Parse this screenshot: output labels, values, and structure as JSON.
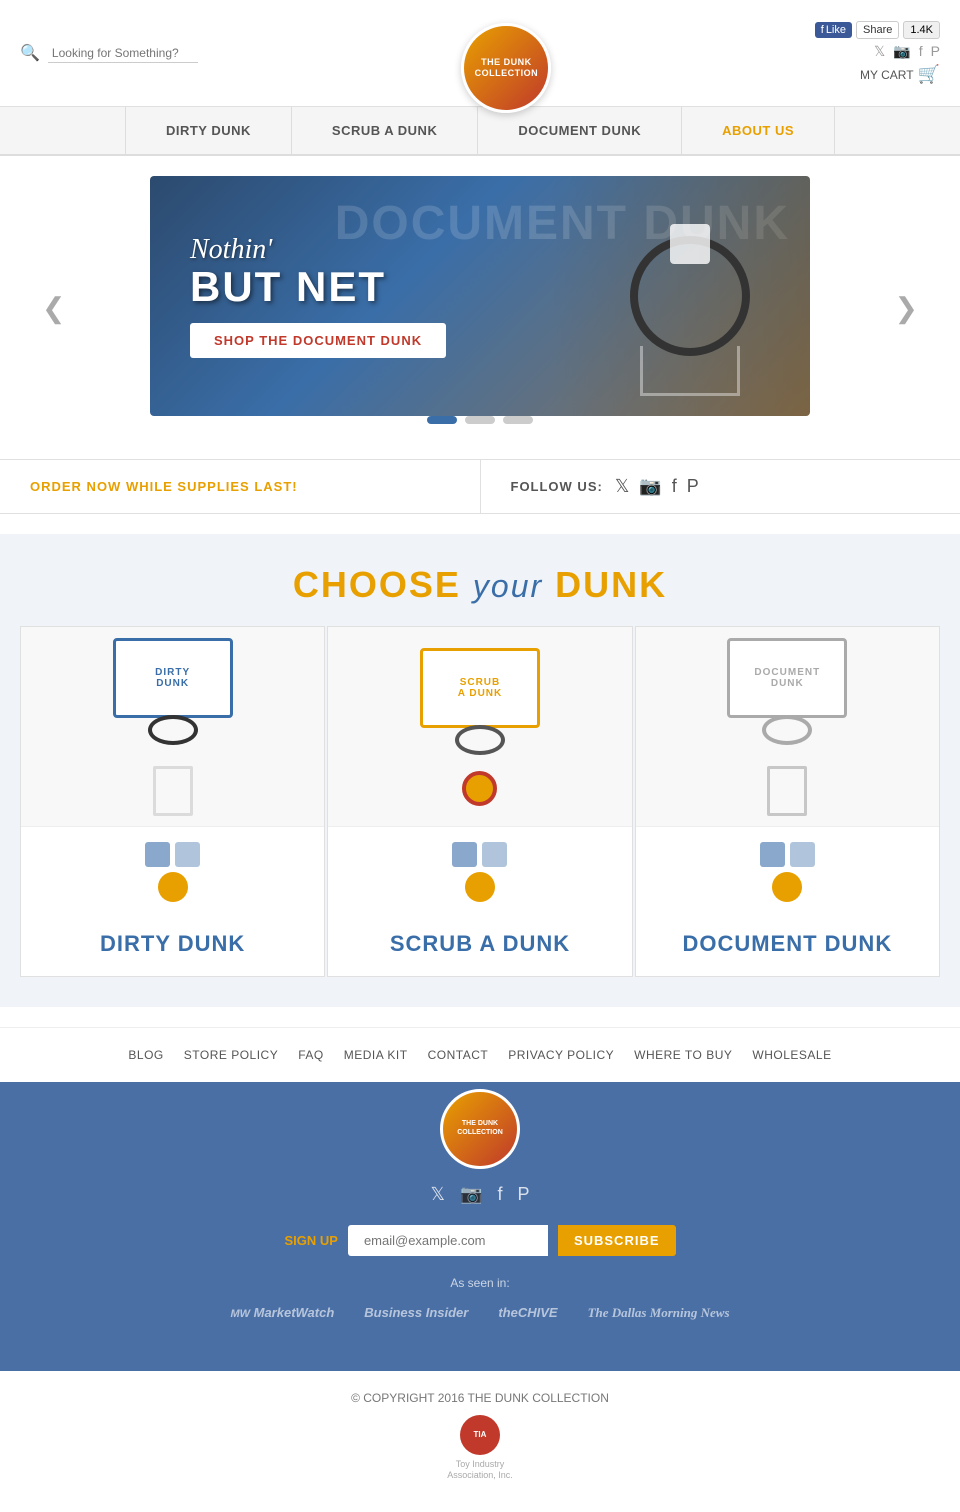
{
  "header": {
    "search_placeholder": "Looking for Something?",
    "logo_text": "THE DUNK COLLECTION",
    "cart_label": "MY CART",
    "like_label": "Like",
    "share_label": "Share",
    "like_count": "1.4K"
  },
  "nav": {
    "items": [
      {
        "label": "DIRTY DUNK"
      },
      {
        "label": "SCRUB A DUNK"
      },
      {
        "label": "DOCUMENT DUNK"
      },
      {
        "label": "ABOUT US"
      }
    ]
  },
  "hero": {
    "slide_script": "Nothin'",
    "slide_bold": "BUT NET",
    "slide_bg": "DOCUMENT DUNK",
    "cta_label": "SHOP THE DOCUMENT DUNK",
    "arrow_left": "❮",
    "arrow_right": "❯"
  },
  "promo": {
    "promo_text": "ORDER NOW WHILE SUPPLIES LAST!",
    "follow_label": "FOLLOW US:"
  },
  "choose": {
    "title_choose": "CHOOSE",
    "title_your": "your",
    "title_dunk": "DUNK",
    "products": [
      {
        "board_label": "DIRTY DUNK",
        "product_label": "DIRTY DUNK"
      },
      {
        "board_label": "SCRUB A DUNK",
        "product_label": "SCRUB A DUNK"
      },
      {
        "board_label": "DOCUMENT DUNK",
        "product_label": "DOCUMENT DUNK"
      }
    ]
  },
  "footer_links": [
    {
      "label": "BLOG"
    },
    {
      "label": "STORE POLICY"
    },
    {
      "label": "FAQ"
    },
    {
      "label": "MEDIA KIT"
    },
    {
      "label": "CONTACT"
    },
    {
      "label": "PRIVACY POLICY"
    },
    {
      "label": "WHERE TO BUY"
    },
    {
      "label": "WHOLESALE"
    }
  ],
  "footer": {
    "signup_label": "SIGN UP",
    "email_placeholder": "email@example.com",
    "subscribe_label": "SUBSCRIBE",
    "as_seen_label": "As seen in:",
    "media": [
      {
        "name": "MarketWatch"
      },
      {
        "name": "Business Insider"
      },
      {
        "name": "theCHIVE"
      },
      {
        "name": "The Dallas Morning News"
      }
    ]
  },
  "copyright": {
    "text": "© COPYRIGHT 2016 THE DUNK COLLECTION",
    "toy_line1": "Toy Industry",
    "toy_line2": "Association, Inc.",
    "toy_badge": "TIA"
  }
}
